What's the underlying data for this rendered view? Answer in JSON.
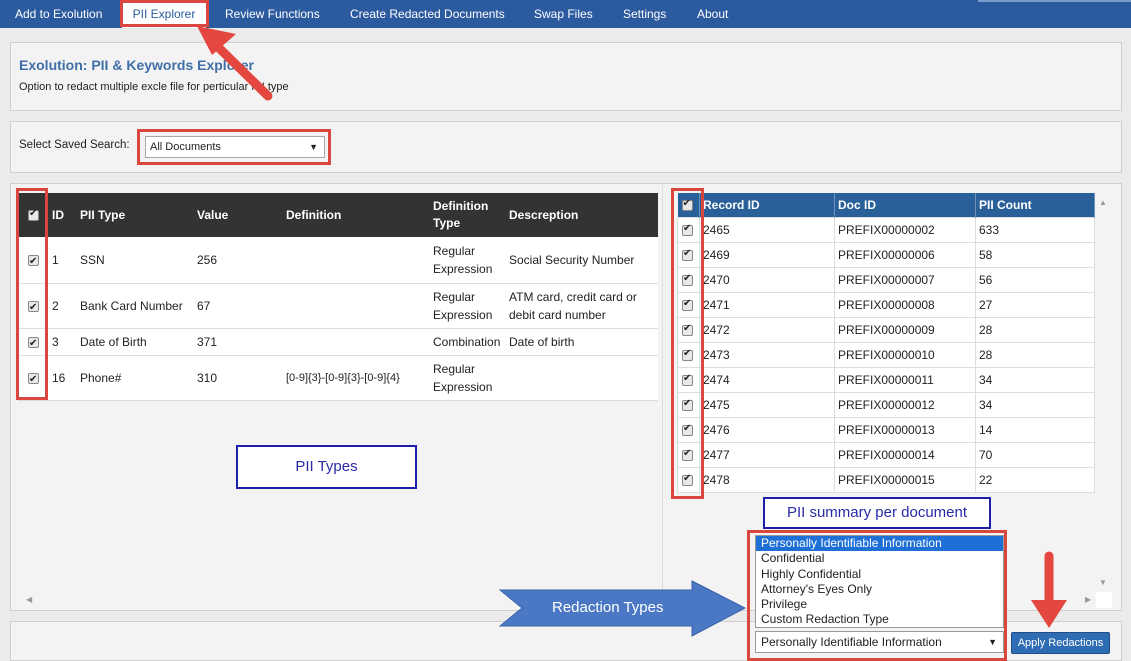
{
  "nav": {
    "items": [
      "Add to Exolution",
      "PII Explorer",
      "Review Functions",
      "Create Redacted Documents",
      "Swap Files",
      "Settings",
      "About"
    ],
    "active": "PII Explorer"
  },
  "header": {
    "title": "Exolution: PII & Keywords Explorer",
    "subtitle": "Option to redact multiple excle file for perticular PII type"
  },
  "saved_search": {
    "label": "Select Saved Search:",
    "value": "All Documents"
  },
  "pii_table": {
    "columns": [
      "ID",
      "PII Type",
      "Value",
      "Definition",
      "Definition Type",
      "Descreption"
    ],
    "rows": [
      {
        "id": "1",
        "type": "SSN",
        "value": "256",
        "definition": "",
        "def_type": "Regular Expression",
        "description": "Social Security Number"
      },
      {
        "id": "2",
        "type": "Bank Card Number",
        "value": "67",
        "definition": "",
        "def_type": "Regular Expression",
        "description": "ATM card, credit card or debit card number"
      },
      {
        "id": "3",
        "type": "Date of Birth",
        "value": "371",
        "definition": "",
        "def_type": "Combination",
        "description": "Date of birth"
      },
      {
        "id": "16",
        "type": "Phone#",
        "value": "310",
        "definition": "[0-9]{3}-[0-9]{3}-[0-9]{4}",
        "def_type": "Regular Expression",
        "description": ""
      }
    ]
  },
  "doc_table": {
    "columns": [
      "Record ID",
      "Doc ID",
      "PII Count"
    ],
    "rows": [
      [
        "2465",
        "PREFIX00000002",
        "633"
      ],
      [
        "2469",
        "PREFIX00000006",
        "58"
      ],
      [
        "2470",
        "PREFIX00000007",
        "56"
      ],
      [
        "2471",
        "PREFIX00000008",
        "27"
      ],
      [
        "2472",
        "PREFIX00000009",
        "28"
      ],
      [
        "2473",
        "PREFIX00000010",
        "28"
      ],
      [
        "2474",
        "PREFIX00000011",
        "34"
      ],
      [
        "2475",
        "PREFIX00000012",
        "34"
      ],
      [
        "2476",
        "PREFIX00000013",
        "14"
      ],
      [
        "2477",
        "PREFIX00000014",
        "70"
      ],
      [
        "2478",
        "PREFIX00000015",
        "22"
      ]
    ]
  },
  "redaction": {
    "options": [
      "Personally Identifiable Information",
      "Confidential",
      "Highly Confidential",
      "Attorney's Eyes Only",
      "Privilege",
      "Custom Redaction Type"
    ],
    "selected": "Personally Identifiable Information",
    "apply_label": "Apply Redactions"
  },
  "annotations": {
    "pii_types": "PII Types",
    "pii_summary": "PII summary per document",
    "redaction_types": "Redaction Types"
  },
  "colors": {
    "nav_bg": "#2b5a9f",
    "table_header_dark": "#333333",
    "table_header_blue": "#2a6099",
    "annotation_red": "#d9473f",
    "annotation_blue": "#1d1fa8",
    "arrow_blue": "#4a78c4"
  }
}
